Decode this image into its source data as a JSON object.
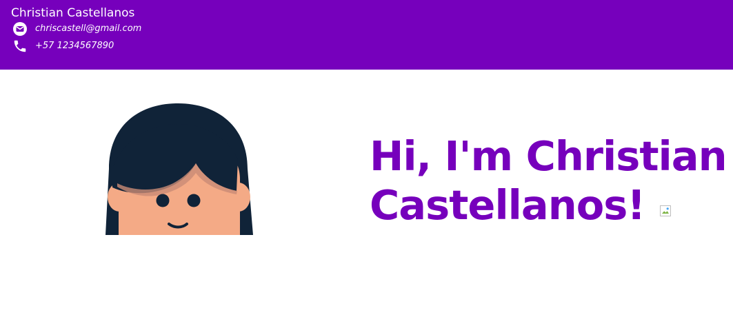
{
  "header": {
    "name": "Christian Castellanos",
    "email": "chriscastell@gmail.com",
    "phone": "+57 1234567890",
    "icons": {
      "email": "email-icon",
      "phone": "phone-icon"
    },
    "background_color": "#7600bc",
    "text_color": "#ffffff"
  },
  "hero": {
    "greeting_line_1": "Hi, I'm Christian",
    "greeting_line_2": "Castellanos!",
    "heading_color": "#7600bc",
    "avatar": {
      "hair_color": "#102338",
      "skin_color": "#f4aa86"
    }
  }
}
